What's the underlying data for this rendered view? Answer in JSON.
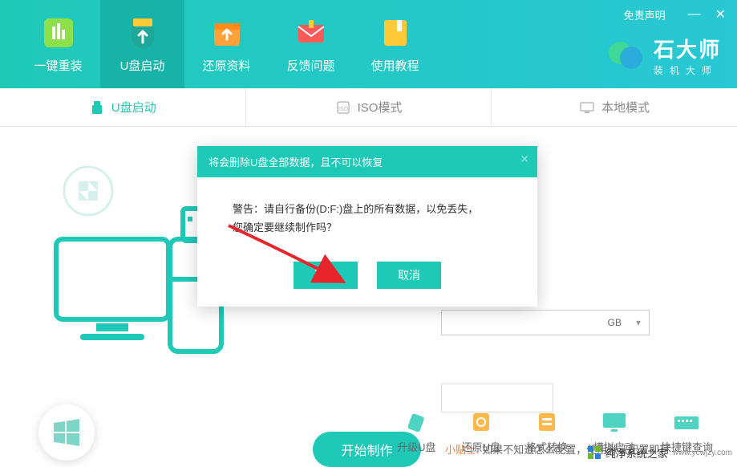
{
  "header": {
    "disclaimer": "免责声明",
    "nav": [
      {
        "label": "一键重装",
        "icon": "reinstall"
      },
      {
        "label": "U盘启动",
        "icon": "usb"
      },
      {
        "label": "还原资料",
        "icon": "restore"
      },
      {
        "label": "反馈问题",
        "icon": "feedback"
      },
      {
        "label": "使用教程",
        "icon": "tutorial"
      }
    ],
    "logo": {
      "title": "石大师",
      "subtitle": "装机大师"
    }
  },
  "tabs": [
    {
      "label": "U盘启动",
      "active": true
    },
    {
      "label": "ISO模式",
      "active": false
    },
    {
      "label": "本地模式",
      "active": false
    }
  ],
  "dropdown": {
    "suffix": "GB"
  },
  "action_button": "开始制作",
  "tips": {
    "label": "小贴士:",
    "text": "如果不知道怎么配置，使用默认配置即可"
  },
  "tools": [
    {
      "label": "升级U盘"
    },
    {
      "label": "还原U盘"
    },
    {
      "label": "格式转换"
    },
    {
      "label": "模拟启动"
    },
    {
      "label": "快捷键查询"
    }
  ],
  "modal": {
    "title": "将会删除U盘全部数据，且不可以恢复",
    "body_line1": "警告：请自行备份(D:F:)盘上的所有数据，以免丢失，",
    "body_line2": "您确定要继续制作吗？",
    "confirm": "确定",
    "cancel": "取消"
  },
  "watermark": {
    "text": "纯净系统之家",
    "url": "www.ycwjzy.com"
  }
}
